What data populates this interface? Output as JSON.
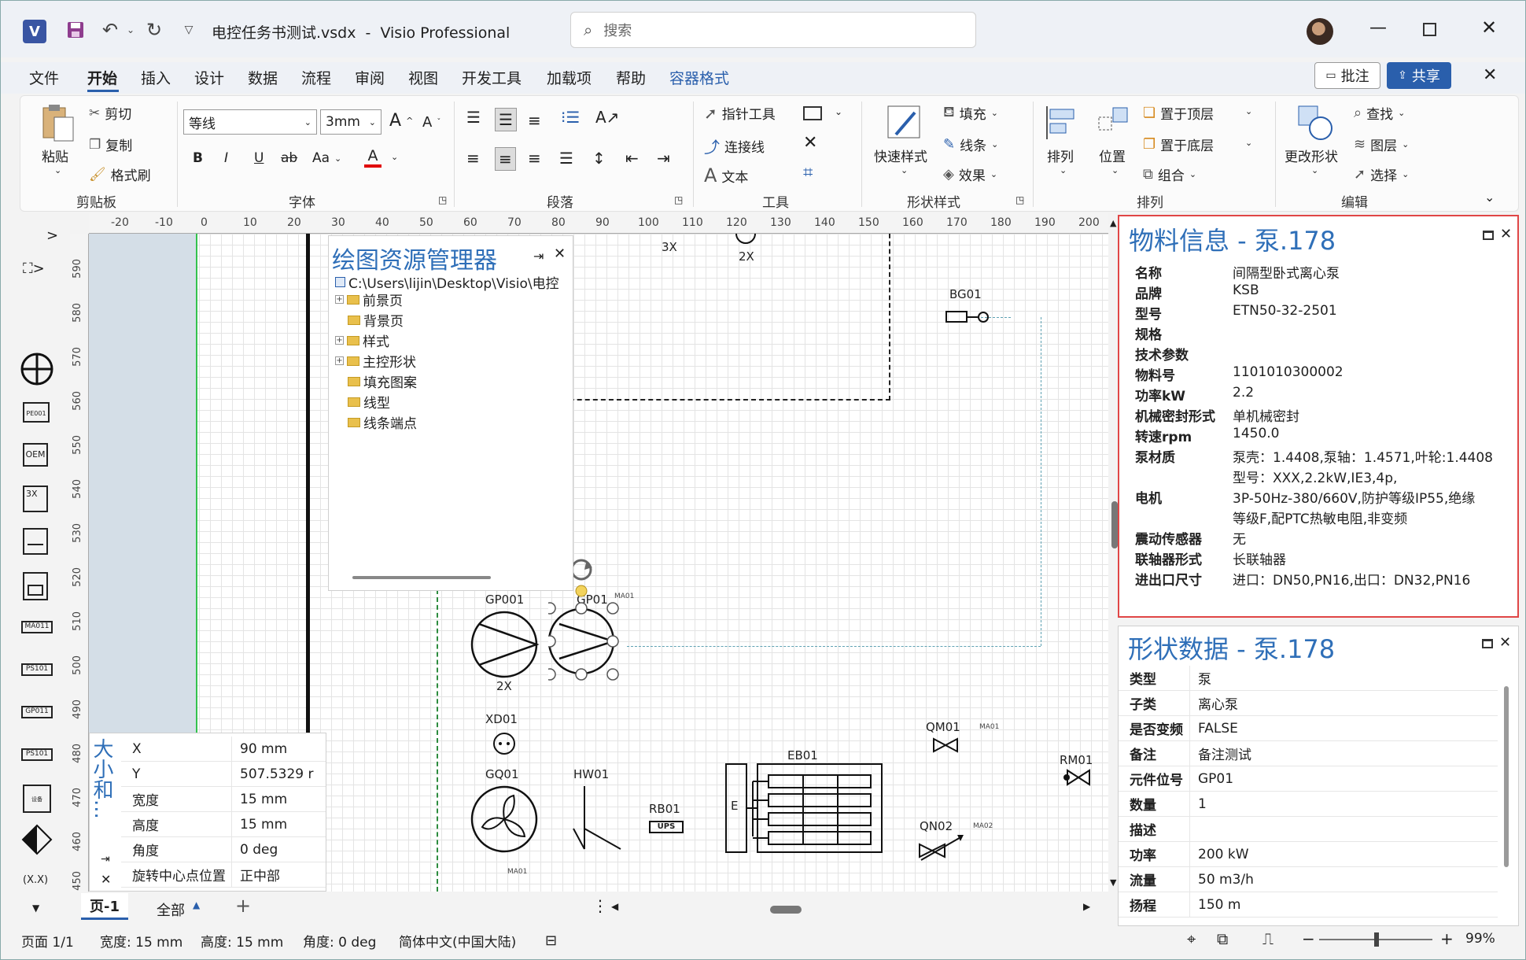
{
  "titlebar": {
    "file_title": "电控任务书测试.vsdx",
    "separator": "-",
    "app_name": "Visio Professional",
    "search_placeholder": "搜索"
  },
  "menu": {
    "items": [
      "文件",
      "开始",
      "插入",
      "设计",
      "数据",
      "流程",
      "审阅",
      "视图",
      "开发工具",
      "加载项",
      "帮助",
      "容器格式"
    ],
    "active": "开始",
    "comment_button": "批注",
    "share_button": "共享"
  },
  "ribbon": {
    "clipboard": {
      "paste": "粘贴",
      "cut": "剪切",
      "copy": "复制",
      "format_painter": "格式刷",
      "label": "剪贴板"
    },
    "font": {
      "family": "等线",
      "size": "3mm",
      "bold": "B",
      "italic": "I",
      "underline": "U",
      "strike": "ab",
      "case": "Aa",
      "color": "A",
      "label": "字体"
    },
    "paragraph": {
      "label": "段落"
    },
    "tools": {
      "pointer": "指针工具",
      "connector": "连接线",
      "text": "文本",
      "label": "工具"
    },
    "shape_style": {
      "quick_style": "快速样式",
      "fill": "填充",
      "line": "线条",
      "effect": "效果",
      "label": "形状样式"
    },
    "arrange": {
      "arrange": "排列",
      "position": "位置",
      "bring_front": "置于顶层",
      "send_back": "置于底层",
      "group": "组合",
      "label": "排列"
    },
    "edit": {
      "change_shape": "更改形状",
      "find": "查找",
      "layer": "图层",
      "select": "选择",
      "label": "编辑"
    }
  },
  "ruler": {
    "h_ticks": [
      "-20",
      "-10",
      "0",
      "10",
      "20",
      "30",
      "40",
      "50",
      "60",
      "70",
      "80",
      "90",
      "100",
      "110",
      "120",
      "130",
      "140",
      "150",
      "160",
      "170",
      "180",
      "190",
      "200"
    ],
    "v_ticks": [
      "590",
      "580",
      "570",
      "560",
      "550",
      "540",
      "530",
      "520",
      "510",
      "500",
      "490",
      "480",
      "470",
      "460",
      "450"
    ]
  },
  "explorer": {
    "title": "绘图资源管理器",
    "root": "C:\\Users\\lijin\\Desktop\\Visio\\电控",
    "items": [
      "前景页",
      "背景页",
      "样式",
      "主控形状",
      "填充图案",
      "线型",
      "线条端点"
    ]
  },
  "size_panel": {
    "title": "大小和...",
    "rows": [
      {
        "k": "X",
        "v": "90 mm"
      },
      {
        "k": "Y",
        "v": "507.5329 r"
      },
      {
        "k": "宽度",
        "v": "15 mm"
      },
      {
        "k": "高度",
        "v": "15 mm"
      },
      {
        "k": "角度",
        "v": "0 deg"
      },
      {
        "k": "旋转中心点位置",
        "v": "正中部"
      }
    ]
  },
  "material_panel": {
    "title": "物料信息 - 泵.178",
    "rows": [
      {
        "k": "名称",
        "v": "间隔型卧式离心泵"
      },
      {
        "k": "品牌",
        "v": "KSB"
      },
      {
        "k": "型号",
        "v": "ETN50-32-2501"
      },
      {
        "k": "规格",
        "v": ""
      },
      {
        "k": "技术参数",
        "v": ""
      },
      {
        "k": "物料号",
        "v": "1101010300002"
      },
      {
        "k": "功率kW",
        "v": "2.2"
      },
      {
        "k": "机械密封形式",
        "v": "单机械密封"
      },
      {
        "k": "转速rpm",
        "v": "1450.0"
      },
      {
        "k": "泵材质",
        "v": "泵壳：1.4408,泵轴：1.4571,叶轮:1.4408"
      },
      {
        "k": "",
        "v": "型号：XXX,2.2kW,IE3,4p,"
      },
      {
        "k": "电机",
        "v": "3P-50Hz-380/660V,防护等级IP55,绝缘"
      },
      {
        "k": "",
        "v": "等级F,配PTC热敏电阻,非变频"
      },
      {
        "k": "震动传感器",
        "v": "无"
      },
      {
        "k": "联轴器形式",
        "v": "长联轴器"
      },
      {
        "k": "进出口尺寸",
        "v": "进口：DN50,PN16,出口：DN32,PN16"
      }
    ]
  },
  "shape_data_panel": {
    "title": "形状数据 - 泵.178",
    "rows": [
      {
        "k": "类型",
        "v": "泵"
      },
      {
        "k": "子类",
        "v": "离心泵"
      },
      {
        "k": "是否变频",
        "v": "FALSE"
      },
      {
        "k": "备注",
        "v": "备注测试"
      },
      {
        "k": "元件位号",
        "v": "GP01"
      },
      {
        "k": "数量",
        "v": "1"
      },
      {
        "k": "描述",
        "v": ""
      },
      {
        "k": "功率",
        "v": "200 kW"
      },
      {
        "k": "流量",
        "v": "50 m3/h"
      },
      {
        "k": "扬程",
        "v": "150 m"
      }
    ]
  },
  "diagram": {
    "labels": {
      "bg01": "BG01",
      "gp001": "GP001",
      "gp01": "GP01",
      "ma01": "MA01",
      "x2a": "2X",
      "x2b": "2X",
      "x3": "3X",
      "xd01": "XD01",
      "gq01": "GQ01",
      "hw01": "HW01",
      "rb01": "RB01",
      "ups": "UPS",
      "eb01": "EB01",
      "e": "E",
      "qm01": "QM01",
      "qn02": "QN02",
      "ma02": "MA02",
      "rm01": "RM01"
    }
  },
  "page_tabs": {
    "page1": "页-1",
    "all": "全部",
    "add": "+"
  },
  "status": {
    "page": "页面 1/1",
    "width": "宽度: 15 mm",
    "height": "高度: 15 mm",
    "angle": "角度: 0 deg",
    "language": "简体中文(中国大陆)",
    "zoom": "99%"
  }
}
